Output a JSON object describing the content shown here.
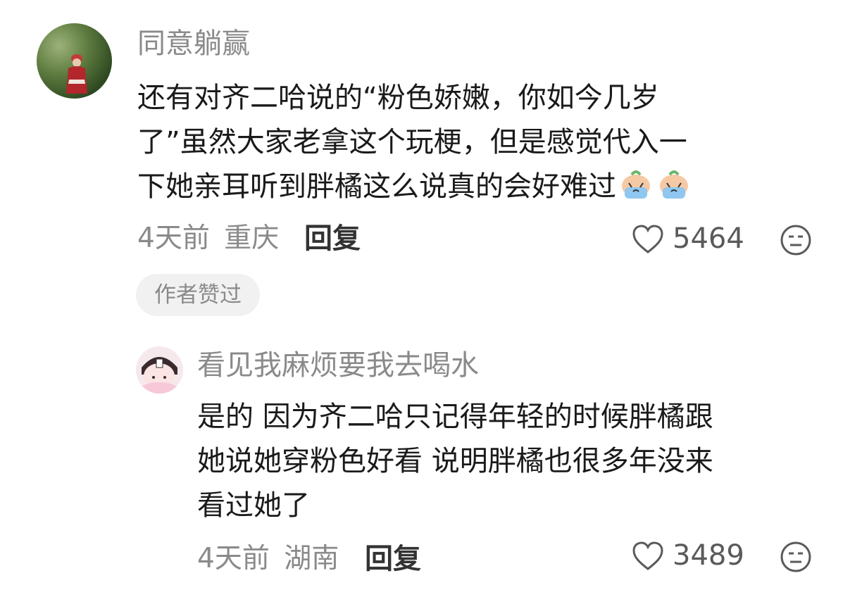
{
  "comments": [
    {
      "username": "同意躺赢",
      "text_line1": "还有对齐二哈说的“粉色娇嫩，你如今几岁",
      "text_line2": "了”虽然大家老拿这个玩梗，但是感觉代入一",
      "text_line3": "下她亲耳听到胖橘这么说真的会好难过",
      "time": "4天前",
      "location": "重庆",
      "reply_label": "回复",
      "likes": "5464",
      "badge": "作者赞过",
      "emoji_icon": "crying-face-emoji"
    },
    {
      "username": "看见我麻烦要我去喝水",
      "text_line1": "是的 因为齐二哈只记得年轻的时候胖橘跟",
      "text_line2": "她说她穿粉色好看 说明胖橘也很多年没来",
      "text_line3": "看过她了",
      "time": "4天前",
      "location": "湖南",
      "reply_label": "回复",
      "likes": "3489"
    }
  ],
  "colors": {
    "text_primary": "#1a1a1a",
    "text_secondary": "#8a8a8a",
    "badge_bg": "#f1f1f1"
  }
}
